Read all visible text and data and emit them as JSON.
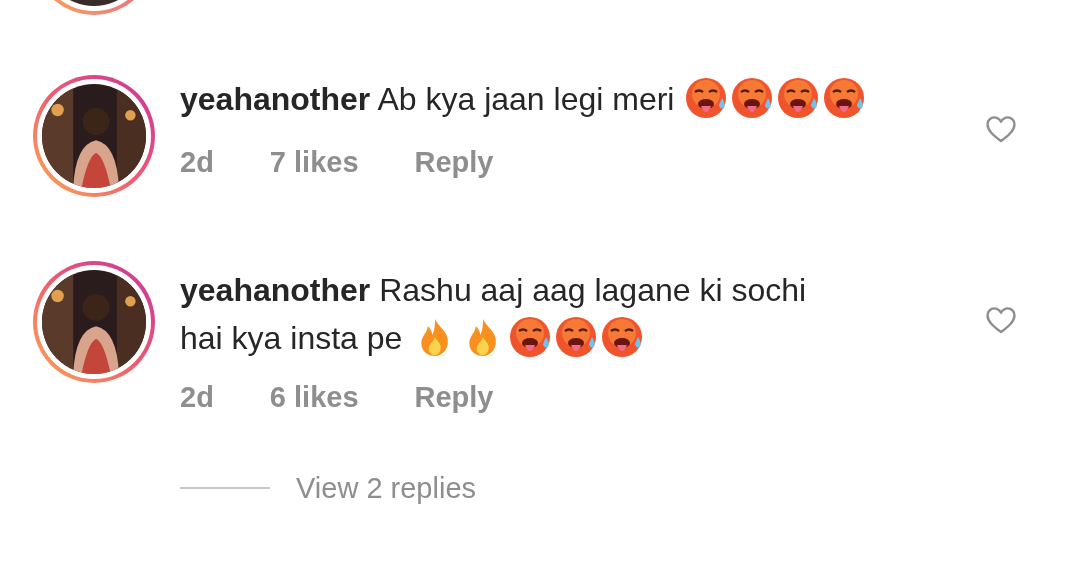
{
  "comments": [
    {
      "username": "yeahanother",
      "text_lines": [
        "Ab kya jaan legi meri"
      ],
      "emojis": [
        {
          "kind": "hot-face"
        },
        {
          "kind": "hot-face"
        },
        {
          "kind": "hot-face"
        },
        {
          "kind": "hot-face"
        }
      ],
      "time": "2d",
      "likes": "7 likes",
      "reply_label": "Reply",
      "liked": false
    },
    {
      "username": "yeahanother",
      "text_lines": [
        "Rashu aaj aag lagane ki sochi",
        "hai kya insta pe"
      ],
      "emojis": [
        {
          "kind": "fire"
        },
        {
          "kind": "fire"
        },
        {
          "kind": "hot-face"
        },
        {
          "kind": "hot-face"
        },
        {
          "kind": "hot-face"
        }
      ],
      "time": "2d",
      "likes": "6 likes",
      "reply_label": "Reply",
      "liked": false,
      "view_replies": "View 2 replies"
    }
  ]
}
